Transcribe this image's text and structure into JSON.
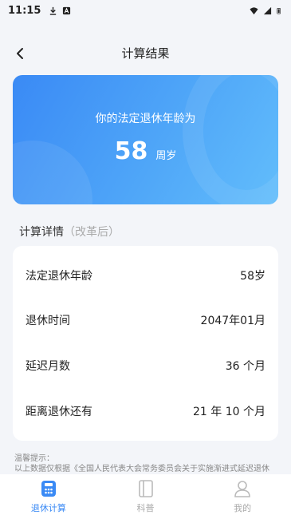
{
  "status_bar": {
    "time": "11:15",
    "left_icons": [
      "download-icon",
      "notification-a-icon"
    ],
    "right_icons": [
      "wifi-icon",
      "signal-icon",
      "battery-icon"
    ]
  },
  "nav": {
    "title": "计算结果",
    "back_icon": "chevron-left-icon"
  },
  "hero": {
    "caption": "你的法定退休年龄为",
    "age_value": "58",
    "age_unit": "周岁",
    "gradient_colors": [
      "#3a8af5",
      "#62bdfb"
    ]
  },
  "details": {
    "title": "计算详情",
    "subtitle": "（改革后）",
    "rows": [
      {
        "label": "法定退休年龄",
        "value": "58岁"
      },
      {
        "label": "退休时间",
        "value": "2047年01月"
      },
      {
        "label": "延迟月数",
        "value": "36 个月"
      },
      {
        "label": "距离退休还有",
        "value": "21 年 10 个月"
      }
    ]
  },
  "notice": {
    "line1": "温馨提示：",
    "line2": "以上数据仅根据《全国人民代表大会常务委员会关于实施渐进式延迟退休"
  },
  "tabbar": {
    "active_color": "#3a8af5",
    "inactive_color": "#aaaaaa",
    "tabs": [
      {
        "label": "退休计算",
        "icon": "calculator-icon",
        "active": true
      },
      {
        "label": "科普",
        "icon": "book-icon",
        "active": false
      },
      {
        "label": "我的",
        "icon": "user-icon",
        "active": false
      }
    ]
  }
}
